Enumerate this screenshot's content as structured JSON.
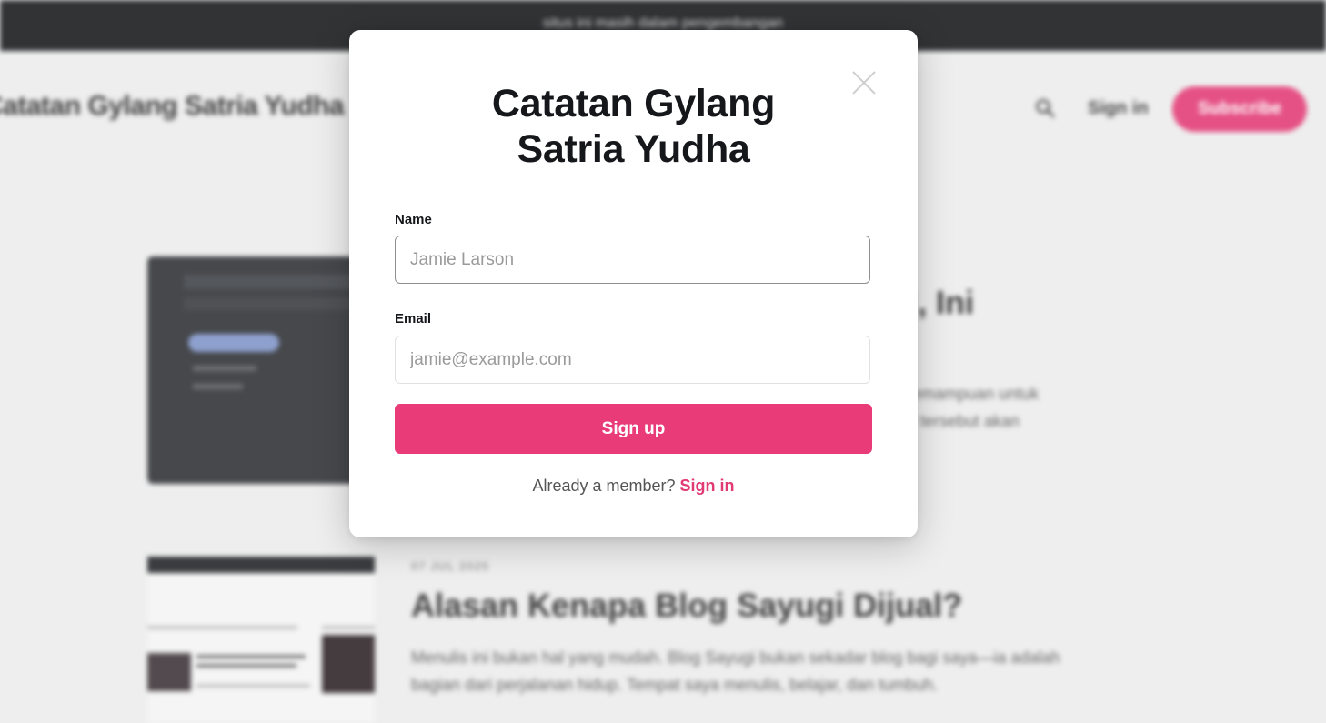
{
  "announcement": "situs ini masih dalam pengembangan",
  "header": {
    "site_title": "Catatan Gylang Satria Yudha",
    "search_icon": "search-icon",
    "signin_label": "Sign in",
    "subscribe_label": "Subscribe"
  },
  "posts": [
    {
      "title_visible": "r!, Ini",
      "excerpt_line1": "emampuan untuk",
      "excerpt_line2": "i tersebut akan"
    },
    {
      "date": "07 JUL 2025",
      "title": "Alasan Kenapa Blog Sayugi Dijual?",
      "excerpt": "Menulis ini bukan hal yang mudah. Blog Sayugi bukan sekadar blog bagi saya—ia adalah bagian dari perjalanan hidup. Tempat saya menulis, belajar, dan tumbuh."
    }
  ],
  "modal": {
    "title_line1": "Catatan Gylang",
    "title_line2": "Satria Yudha",
    "close_icon": "close-icon",
    "name_label": "Name",
    "name_placeholder": "Jamie Larson",
    "email_label": "Email",
    "email_placeholder": "jamie@example.com",
    "signup_label": "Sign up",
    "member_text": "Already a member?",
    "signin_link": "Sign in"
  },
  "colors": {
    "accent": "#e83b77",
    "announcement_bg": "#15171a"
  }
}
